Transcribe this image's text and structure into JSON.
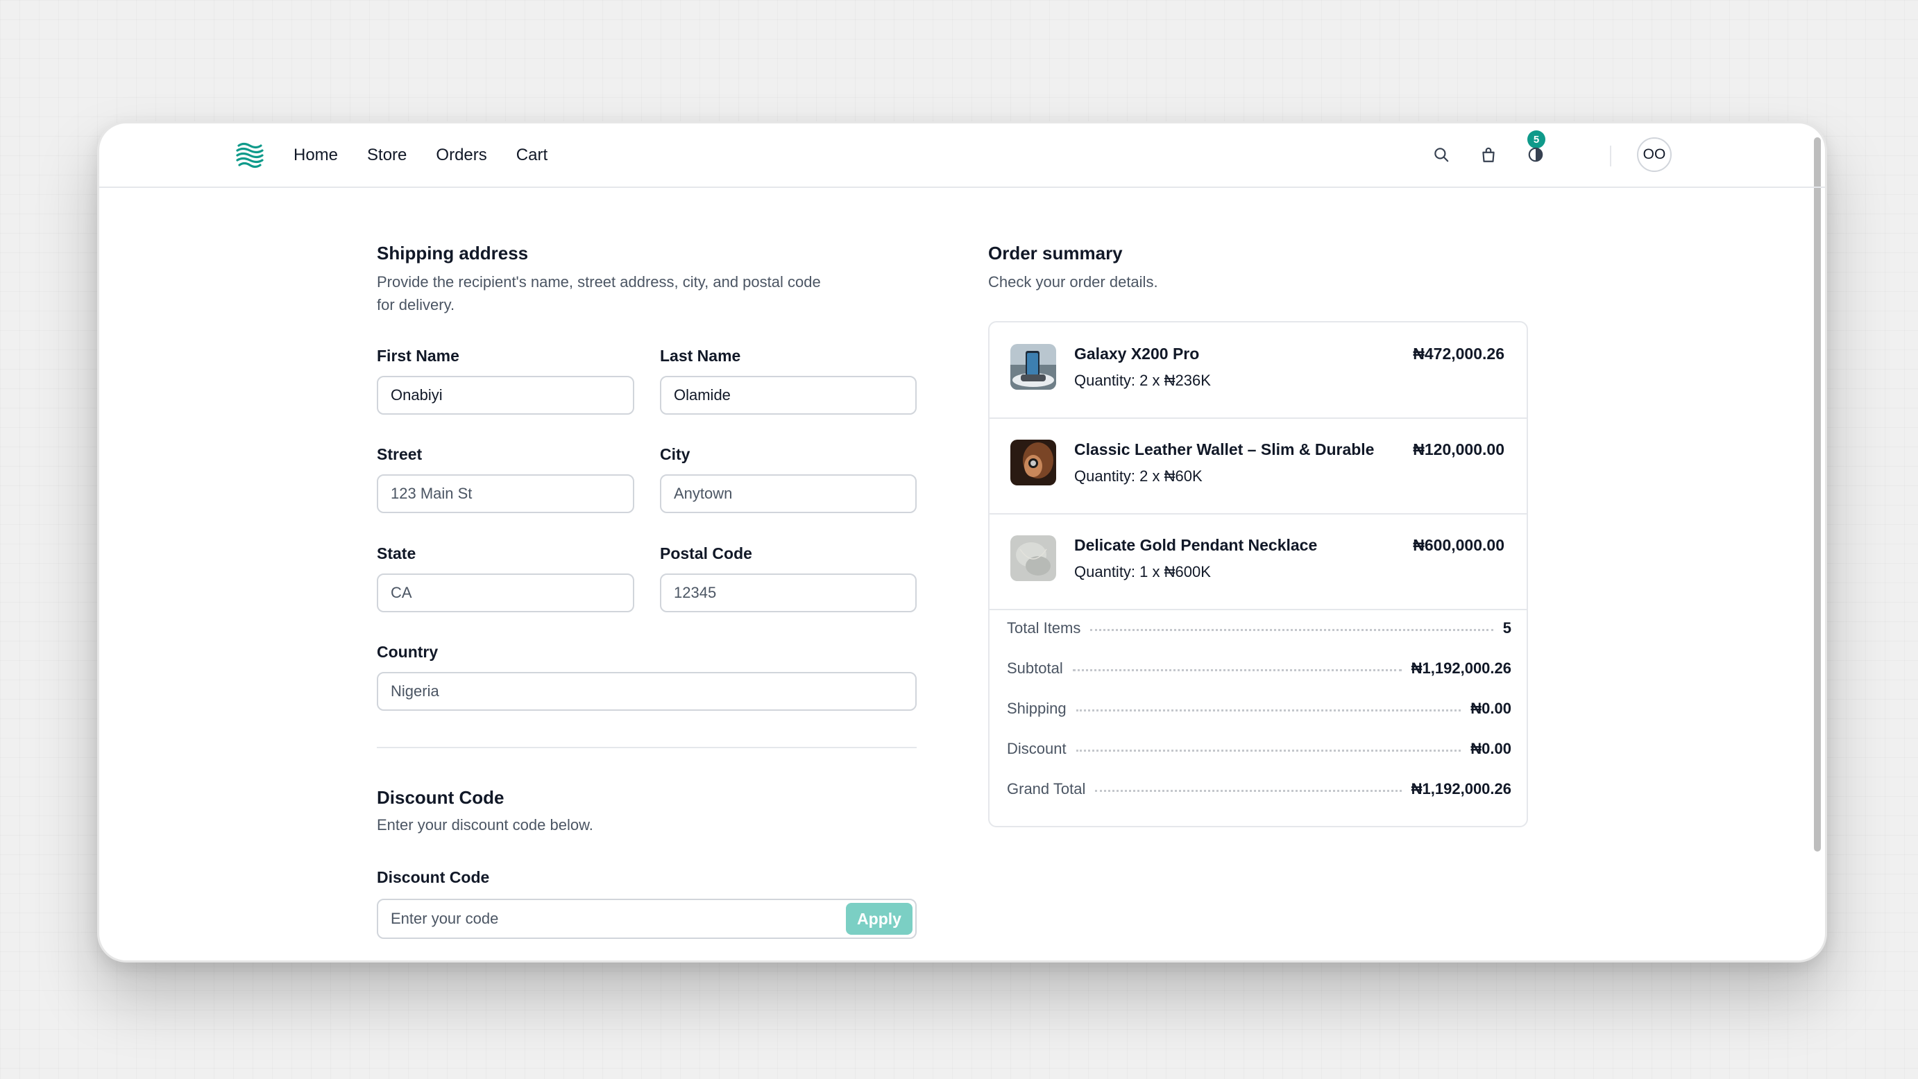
{
  "nav": {
    "items": [
      "Home",
      "Store",
      "Orders",
      "Cart"
    ]
  },
  "header": {
    "cart_count": "5",
    "avatar_initials": "OO"
  },
  "shipping": {
    "title": "Shipping address",
    "description_line1": "Provide the recipient's name, street address, city, and postal code",
    "description_line2": "for delivery.",
    "fields": {
      "first_name": {
        "label": "First Name",
        "value": "Onabiyi"
      },
      "last_name": {
        "label": "Last Name",
        "value": "Olamide"
      },
      "street": {
        "label": "Street",
        "placeholder": "123 Main St"
      },
      "city": {
        "label": "City",
        "placeholder": "Anytown"
      },
      "state": {
        "label": "State",
        "placeholder": "CA"
      },
      "postal_code": {
        "label": "Postal Code",
        "placeholder": "12345"
      },
      "country": {
        "label": "Country",
        "placeholder": "Nigeria"
      }
    }
  },
  "discount": {
    "title": "Discount Code",
    "description": "Enter your discount code below.",
    "field_label": "Discount Code",
    "placeholder": "Enter your code",
    "apply_label": "Apply"
  },
  "summary": {
    "title": "Order summary",
    "description": "Check your order details.",
    "items": [
      {
        "name": "Galaxy X200 Pro",
        "quantity": "Quantity: 2 x ₦236K",
        "price": "₦472,000.26"
      },
      {
        "name": "Classic Leather Wallet – Slim & Durable",
        "quantity": "Quantity: 2 x ₦60K",
        "price": "₦120,000.00"
      },
      {
        "name": "Delicate Gold Pendant Necklace",
        "quantity": "Quantity: 1 x ₦600K",
        "price": "₦600,000.00"
      }
    ],
    "totals": [
      {
        "label": "Total Items",
        "value": "5"
      },
      {
        "label": "Subtotal",
        "value": "₦1,192,000.26"
      },
      {
        "label": "Shipping",
        "value": "₦0.00"
      },
      {
        "label": "Discount",
        "value": "₦0.00"
      },
      {
        "label": "Grand Total",
        "value": "₦1,192,000.26"
      }
    ]
  },
  "colors": {
    "accent": "#0f9a8a",
    "apply_button": "#7bcfc4"
  },
  "icons": [
    "logo-waves-icon",
    "search-icon",
    "shopping-bag-icon",
    "theme-toggle-icon"
  ]
}
